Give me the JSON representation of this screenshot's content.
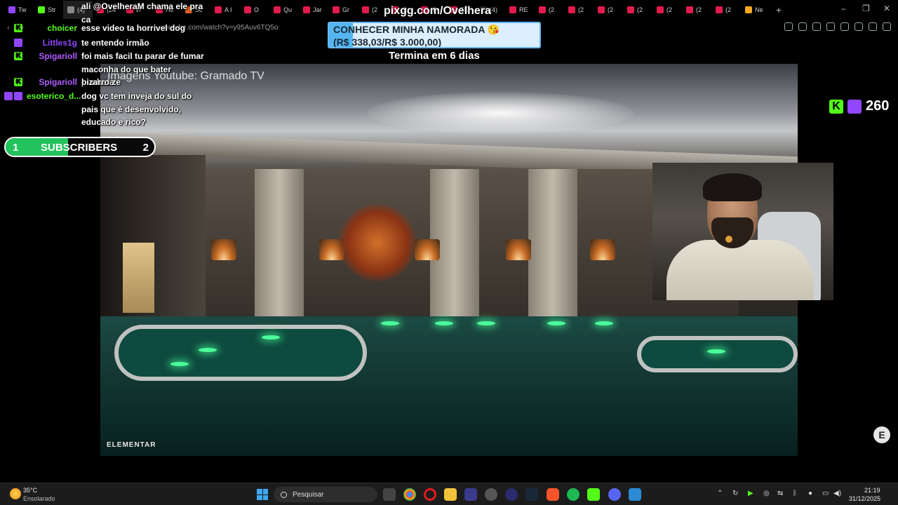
{
  "browser": {
    "tabs": [
      {
        "label": "Tw",
        "color": "#9146ff"
      },
      {
        "label": "Str",
        "color": "#53fc18"
      },
      {
        "label": "(4)",
        "color": "#888888"
      },
      {
        "label": "(24",
        "color": "#e21b4d"
      },
      {
        "label": "И",
        "color": "#e21b4d"
      },
      {
        "label": "He",
        "color": "#e21b4d"
      },
      {
        "label": "Sc",
        "color": "#e8601c"
      },
      {
        "label": "A I",
        "color": "#e21b4d"
      },
      {
        "label": "O",
        "color": "#e21b4d"
      },
      {
        "label": "Qu",
        "color": "#e21b4d"
      },
      {
        "label": "Jar",
        "color": "#e21b4d"
      },
      {
        "label": "Gr",
        "color": "#e21b4d"
      },
      {
        "label": "(2",
        "color": "#e21b4d"
      },
      {
        "label": "(2",
        "color": "#e21b4d"
      },
      {
        "label": "(2",
        "color": "#e21b4d"
      },
      {
        "label": "TE",
        "color": "#e21b4d"
      },
      {
        "label": "(4)",
        "color": "#222222"
      },
      {
        "label": "RE",
        "color": "#e21b4d"
      },
      {
        "label": "(2",
        "color": "#e21b4d"
      },
      {
        "label": "(2",
        "color": "#e21b4d"
      },
      {
        "label": "(2",
        "color": "#e21b4d"
      },
      {
        "label": "(2",
        "color": "#e21b4d"
      },
      {
        "label": "(2",
        "color": "#e21b4d"
      },
      {
        "label": "(2",
        "color": "#e21b4d"
      },
      {
        "label": "(2",
        "color": "#e21b4d"
      },
      {
        "label": "Ne",
        "color": "#f5a623"
      }
    ],
    "url": "youtube.com/watch?v=y95Auv6TQ5o"
  },
  "chat": [
    {
      "icons": [],
      "user": "",
      "user_color": "#ffffff",
      "lines": "ali @OvelheraM chama ele pra ca"
    },
    {
      "icons": [
        "kick"
      ],
      "user": "choicer",
      "user_color": "#53fc18",
      "lines": "esse video ta horrivel dog"
    },
    {
      "icons": [
        "twitch"
      ],
      "user": "Littles1g",
      "user_color": "#9146ff",
      "lines": "te entendo irmão"
    },
    {
      "icons": [
        "kick"
      ],
      "user": "Spigarioll",
      "user_color": "#b05cff",
      "lines": "foi mais facil tu parar de fumar maconha do que bater punheta"
    },
    {
      "icons": [
        "kick"
      ],
      "user": "Spigarioll",
      "user_color": "#b05cff",
      "lines": "bizarro ze"
    },
    {
      "icons": [
        "twitch",
        "twitch"
      ],
      "user": "esoterico_d...",
      "user_color": "#53fc18",
      "lines": "dog vc tem inveja do sul do pais que é desenvolvido, educado e rico?"
    }
  ],
  "donation": {
    "pix_title": "pixgg.com/Ovelhera",
    "goal_title": "CONHECER MINHA NAMORADA 😘",
    "goal_amount": "(R$ 338,03/R$ 3.000,00)",
    "goal_current": 338.03,
    "goal_target": 3000.0,
    "ends_text": "Termina em 6 dias"
  },
  "subscribers": {
    "start": "1",
    "label": "SUBSCRIBERS",
    "end": "2",
    "progress": 0.42
  },
  "viewers": {
    "count": "260"
  },
  "video": {
    "caption": "Imagens Youtube: Gramado TV",
    "logo": "ELEMENTAR"
  },
  "badge": {
    "label": "E"
  },
  "taskbar": {
    "temp": "35°C",
    "weather": "Ensolarado",
    "search_placeholder": "Pesquisar",
    "time": "21:19",
    "date": "31/12/2025"
  }
}
